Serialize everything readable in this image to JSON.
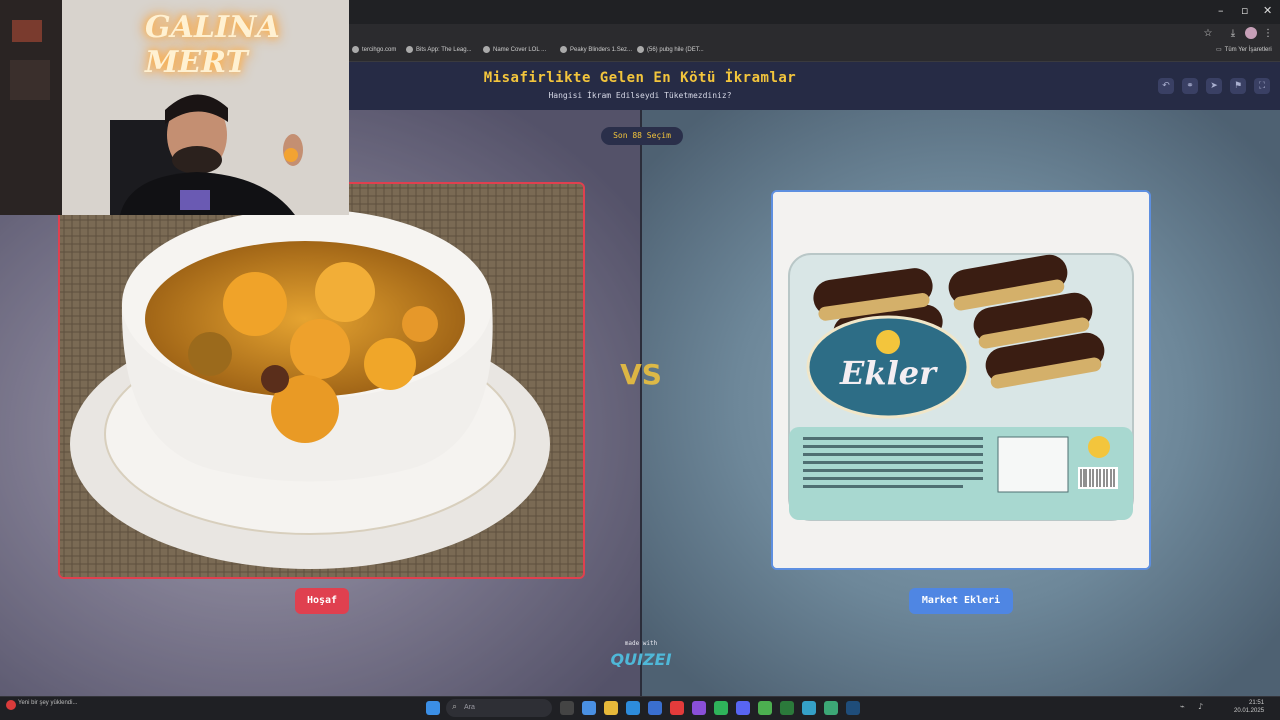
{
  "browser": {
    "bookmarks": [
      "tercihgo.com",
      "Bits App: The Leag...",
      "Name Cover LOL ...",
      "Peaky Blinders 1.Sez...",
      "(56) pubg hile (DET..."
    ],
    "all_bookmarks": "Tüm Yer İşaretleri"
  },
  "quiz": {
    "title": "Misafirlikte Gelen En Kötü İkramlar",
    "subtitle": "Hangisi İkram Edilseydi Tüketmezdiniz?",
    "round_badge": "Son 88 Seçim",
    "left_option": {
      "label": "Hoşaf"
    },
    "right_option": {
      "label": "Market Ekleri",
      "package_text": "Ekler"
    },
    "vs": "VS",
    "made_with": "made with",
    "brand": "QUIZEI"
  },
  "webcam": {
    "sign_text": "GALINA MERT"
  },
  "taskbar": {
    "search_placeholder": "Ara",
    "notification": "Yeni bir şey yüklendi...",
    "time": "21:51",
    "date": "20.01.2025"
  }
}
